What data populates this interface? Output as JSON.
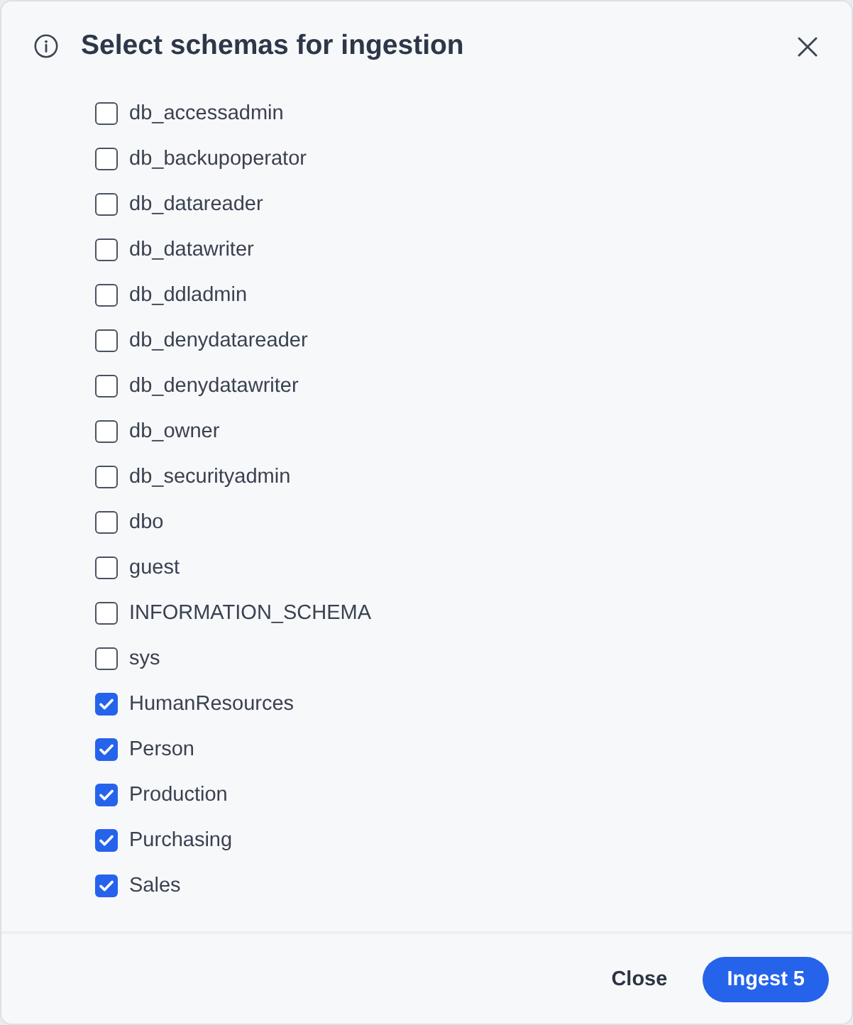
{
  "dialog": {
    "title": "Select schemas for ingestion",
    "schemas": [
      {
        "label": "db_accessadmin",
        "checked": false
      },
      {
        "label": "db_backupoperator",
        "checked": false
      },
      {
        "label": "db_datareader",
        "checked": false
      },
      {
        "label": "db_datawriter",
        "checked": false
      },
      {
        "label": "db_ddladmin",
        "checked": false
      },
      {
        "label": "db_denydatareader",
        "checked": false
      },
      {
        "label": "db_denydatawriter",
        "checked": false
      },
      {
        "label": "db_owner",
        "checked": false
      },
      {
        "label": "db_securityadmin",
        "checked": false
      },
      {
        "label": "dbo",
        "checked": false
      },
      {
        "label": "guest",
        "checked": false
      },
      {
        "label": "INFORMATION_SCHEMA",
        "checked": false
      },
      {
        "label": "sys",
        "checked": false
      },
      {
        "label": "HumanResources",
        "checked": true
      },
      {
        "label": "Person",
        "checked": true
      },
      {
        "label": "Production",
        "checked": true
      },
      {
        "label": "Purchasing",
        "checked": true
      },
      {
        "label": "Sales",
        "checked": true
      }
    ],
    "buttons": [
      {
        "label": "Close",
        "kind": "secondary"
      },
      {
        "label": "Ingest 5",
        "kind": "primary"
      }
    ]
  }
}
